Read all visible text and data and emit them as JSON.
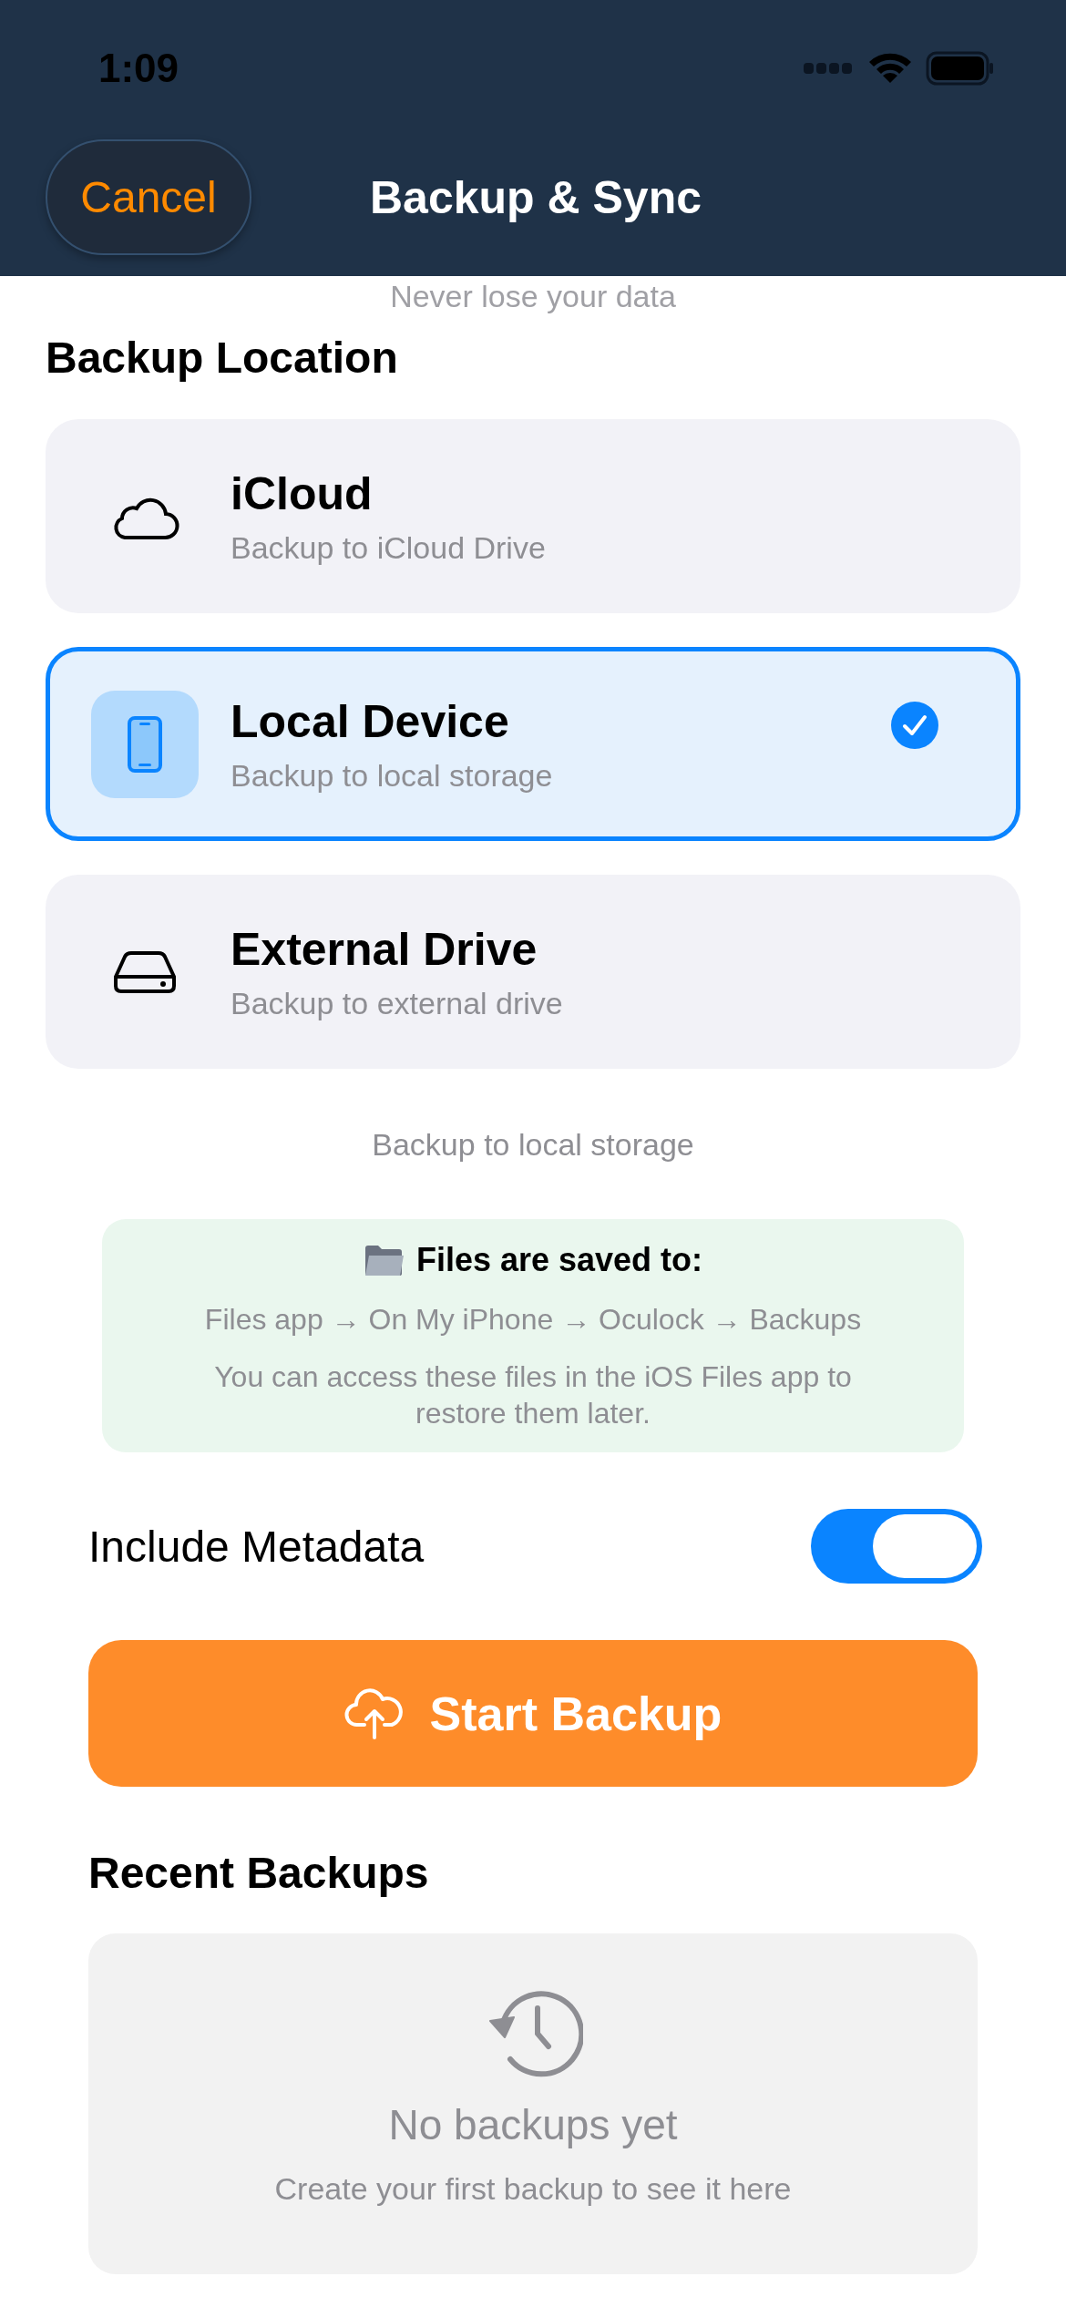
{
  "status_bar": {
    "time": "1:09"
  },
  "nav": {
    "cancel": "Cancel",
    "title": "Backup & Sync"
  },
  "subtitle": "Never lose your data",
  "backup_location": {
    "heading": "Backup Location",
    "options": [
      {
        "title": "iCloud",
        "description": "Backup to iCloud Drive",
        "selected": false
      },
      {
        "title": "Local Device",
        "description": "Backup to local storage",
        "selected": true
      },
      {
        "title": "External Drive",
        "description": "Backup to external drive",
        "selected": false
      }
    ]
  },
  "selected_description": "Backup to local storage",
  "info": {
    "title": "Files are saved to:",
    "path": "Files app → On My iPhone → Oculock → Backups",
    "note": "You can access these files in the iOS Files app to restore them later."
  },
  "include_metadata": {
    "label": "Include Metadata",
    "on": true
  },
  "start_button": "Start Backup",
  "recent": {
    "heading": "Recent Backups",
    "empty_title": "No backups yet",
    "empty_text": "Create your first backup to see it here"
  }
}
